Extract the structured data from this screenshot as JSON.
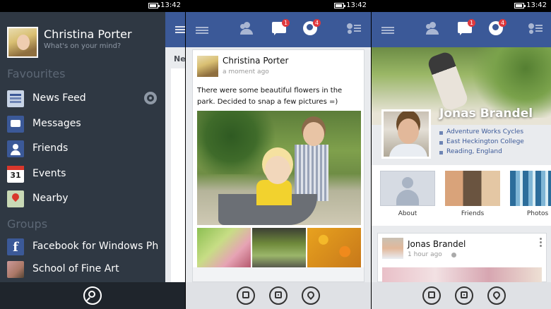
{
  "status": {
    "time": "13:42"
  },
  "menu": {
    "profile_name": "Christina Porter",
    "profile_sub": "What's on your mind?",
    "favourites_label": "Favourites",
    "groups_label": "Groups",
    "items": [
      {
        "label": "News Feed",
        "icon": "news-feed-icon"
      },
      {
        "label": "Messages",
        "icon": "messages-icon"
      },
      {
        "label": "Friends",
        "icon": "friends-icon"
      },
      {
        "label": "Events",
        "icon": "events-icon",
        "icon_text": "31"
      },
      {
        "label": "Nearby",
        "icon": "nearby-icon"
      }
    ],
    "groups": [
      {
        "label": "Facebook for Windows Ph",
        "icon": "facebook-icon",
        "icon_text": "f"
      },
      {
        "label": "School of Fine Art",
        "icon": "group-icon"
      }
    ],
    "peek_label": "Ne"
  },
  "header": {
    "messages_badge": "1",
    "notifications_badge": "4"
  },
  "post": {
    "author": "Christina Porter",
    "time": "a moment ago",
    "text": "There were some beautiful flowers in the park. Decided to snap a few pictures =)"
  },
  "profile": {
    "name": "Jonas Brandel",
    "info": [
      "Adventure Works Cycles",
      "East Heckington College",
      "Reading, England"
    ],
    "tiles": [
      "About",
      "Friends",
      "Photos"
    ],
    "post_author": "Jonas Brandel",
    "post_time": "1 hour ago"
  },
  "colors": {
    "brand": "#3b5998",
    "menu_bg": "#2f3843",
    "badge": "#e0393e"
  }
}
